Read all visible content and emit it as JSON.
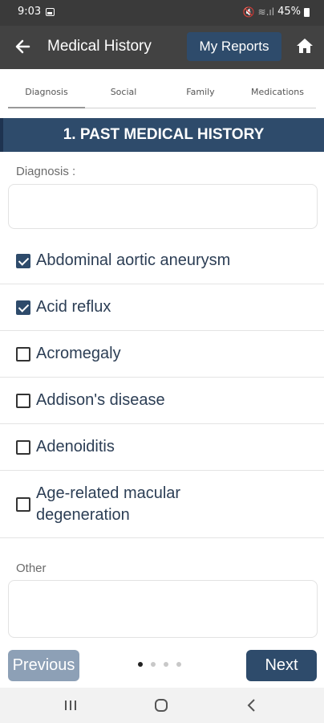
{
  "status_bar": {
    "time": "9:03",
    "battery": "45%"
  },
  "app_bar": {
    "title": "Medical History",
    "reports_button": "My Reports"
  },
  "tabs": [
    {
      "label": "Diagnosis",
      "active": true
    },
    {
      "label": "Social",
      "active": false
    },
    {
      "label": "Family",
      "active": false
    },
    {
      "label": "Medications",
      "active": false
    }
  ],
  "section": {
    "title": "1. PAST MEDICAL HISTORY",
    "diagnosis_label": "Diagnosis :",
    "diagnosis_value": "",
    "other_label": "Other",
    "other_value": ""
  },
  "conditions": [
    {
      "label": "Abdominal aortic aneurysm",
      "checked": true
    },
    {
      "label": "Acid reflux",
      "checked": true
    },
    {
      "label": "Acromegaly",
      "checked": false
    },
    {
      "label": "Addison's disease",
      "checked": false
    },
    {
      "label": "Adenoiditis",
      "checked": false
    },
    {
      "label": "Age-related macular degeneration",
      "checked": false
    }
  ],
  "footer": {
    "previous": "Previous",
    "next": "Next",
    "page_index": 1,
    "page_count": 4
  },
  "colors": {
    "primary": "#2e4b6b",
    "appbar": "#424242",
    "statusbar": "#3a3a3a",
    "disabled_button": "#8da0b6"
  }
}
